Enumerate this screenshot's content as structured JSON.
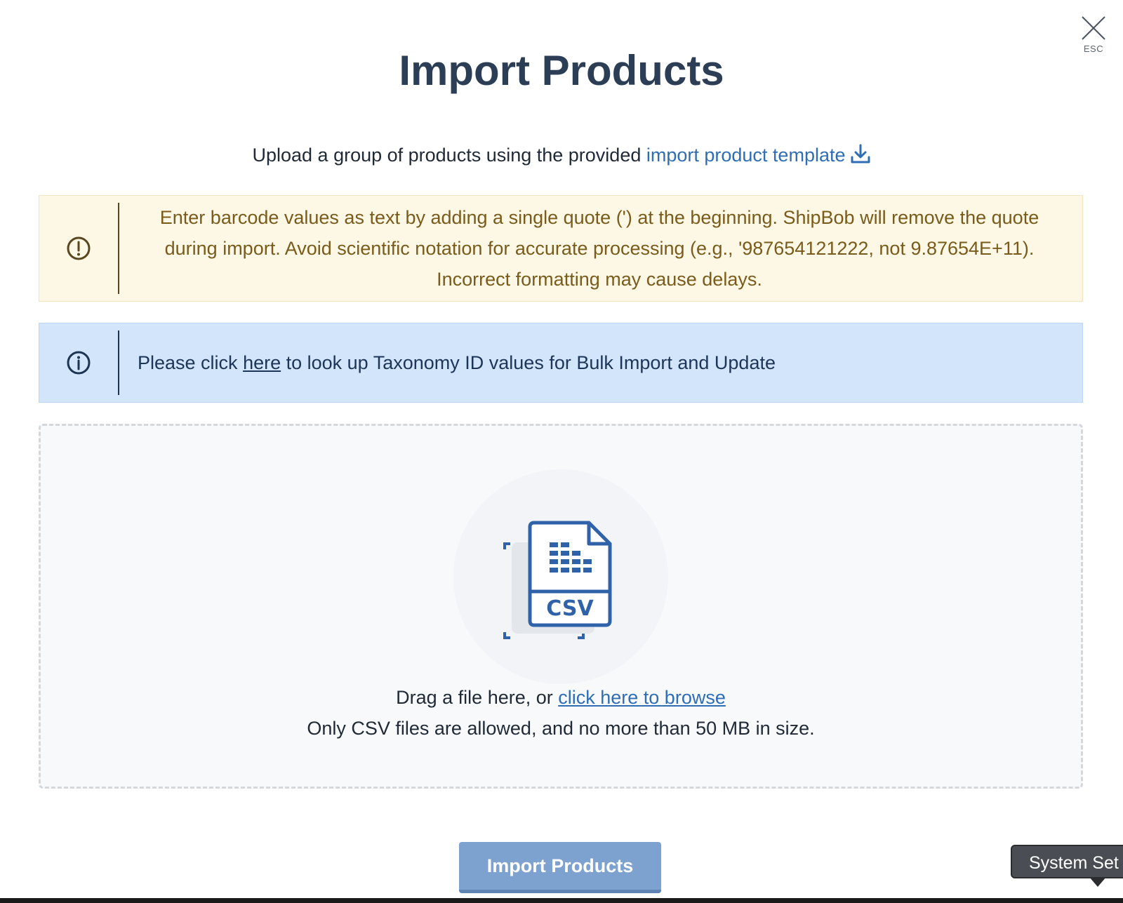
{
  "modal": {
    "title": "Import Products",
    "close_label": "ESC"
  },
  "subtitle": {
    "text": "Upload a group of products using the provided ",
    "link_label": "import product template"
  },
  "warning_alert": {
    "text": "Enter barcode values as text by adding a single quote (') at the beginning. ShipBob will remove the quote during import. Avoid scientific notation for accurate processing (e.g., '987654121222, not 9.87654E+11). Incorrect formatting may cause delays."
  },
  "info_alert": {
    "prefix": "Please click ",
    "link_label": "here",
    "suffix": " to look up Taxonomy ID values for Bulk Import and Update"
  },
  "dropzone": {
    "icon_label": "CSV",
    "drag_text": "Drag a file here, or ",
    "browse_label": "click here to browse",
    "hint": "Only CSV files are allowed, and no more than 50 MB in size."
  },
  "footer": {
    "import_button_label": "Import Products"
  },
  "tooltip": {
    "text": "System Set"
  },
  "colors": {
    "title": "#2c3e55",
    "link": "#2f6eb5",
    "warning_bg": "#fcf8e5",
    "warning_text": "#7a5b1b",
    "info_bg": "#d3e5fa",
    "info_text": "#1c3558",
    "button_bg": "#7ea2cf",
    "csv_icon": "#2f62a8"
  },
  "icons": {
    "close": "close-icon",
    "download": "download-icon",
    "warning": "exclamation-circle-icon",
    "info": "info-circle-icon",
    "file": "csv-file-icon"
  }
}
